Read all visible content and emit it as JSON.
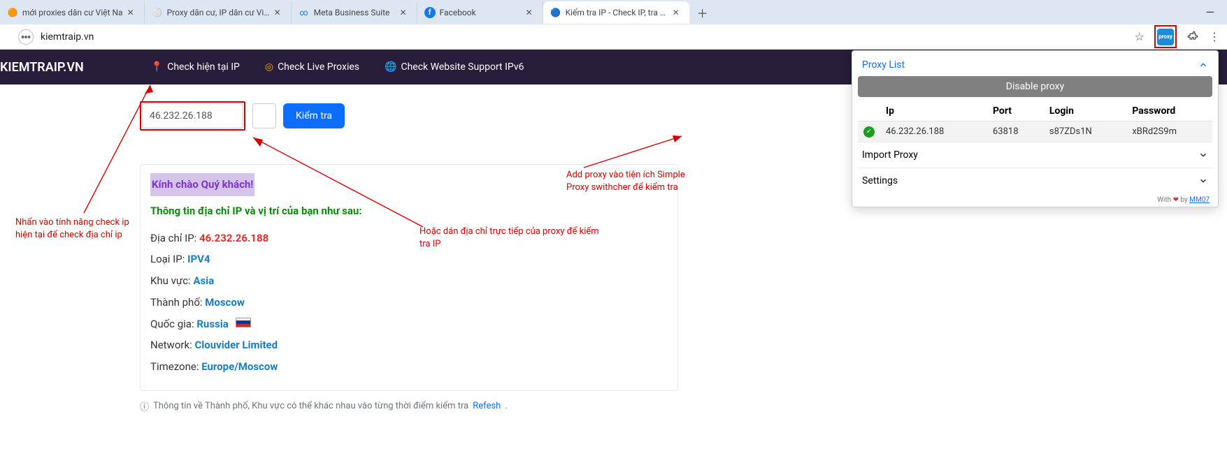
{
  "browser": {
    "tabs": [
      {
        "title": "mới proxies dân cư Việt Na"
      },
      {
        "title": "Proxy dân cư, IP dân cư Việt Na"
      },
      {
        "title": "Meta Business Suite"
      },
      {
        "title": "Facebook"
      },
      {
        "title": "Kiểm tra IP - Check IP, tra địa c"
      }
    ],
    "address": "kiemtraip.vn"
  },
  "nav": {
    "brand": "KIEMTRAIP.VN",
    "items": [
      "Check hiện tại IP",
      "Check Live Proxies",
      "Check Website Support IPv6"
    ]
  },
  "search": {
    "ip_value": "46.232.26.188",
    "button": "Kiểm tra"
  },
  "card": {
    "greeting": "Kính chào Quý khách!",
    "heading": "Thông tin địa chỉ IP và vị trí của bạn như sau:",
    "rows": {
      "ip_label": "Địa chỉ IP:",
      "ip_value": "46.232.26.188",
      "type_label": "Loại IP:",
      "type_value": "IPV4",
      "region_label": "Khu vực:",
      "region_value": "Asia",
      "city_label": "Thành phố:",
      "city_value": "Moscow",
      "country_label": "Quốc gia:",
      "country_value": "Russia",
      "network_label": "Network:",
      "network_value": "Clouvider Limited",
      "tz_label": "Timezone:",
      "tz_value": "Europe/Moscow"
    }
  },
  "footer": {
    "text": "Thông tin về Thành phố, Khu vực có thể khác nhau vào từng thời điểm kiểm tra",
    "link": "Refesh"
  },
  "ext": {
    "title": "Proxy List",
    "disable": "Disable proxy",
    "cols": {
      "ip": "Ip",
      "port": "Port",
      "login": "Login",
      "password": "Password"
    },
    "row": {
      "ip": "46.232.26.188",
      "port": "63818",
      "login": "s87ZDs1N",
      "password": "xBRd2S9m"
    },
    "import": "Import Proxy",
    "settings": "Settings",
    "footer_prefix": "With",
    "footer_by": "by",
    "footer_link": "MM07"
  },
  "annotations": {
    "a1": "Nhấn vào tính năng check ip hiện tại để check địa chỉ ip",
    "a2": "Hoặc dán địa chỉ trực tiếp của proxy để kiểm tra IP",
    "a3": "Add proxy vào tiện ích Simple Proxy swithcher để kiểm tra"
  }
}
